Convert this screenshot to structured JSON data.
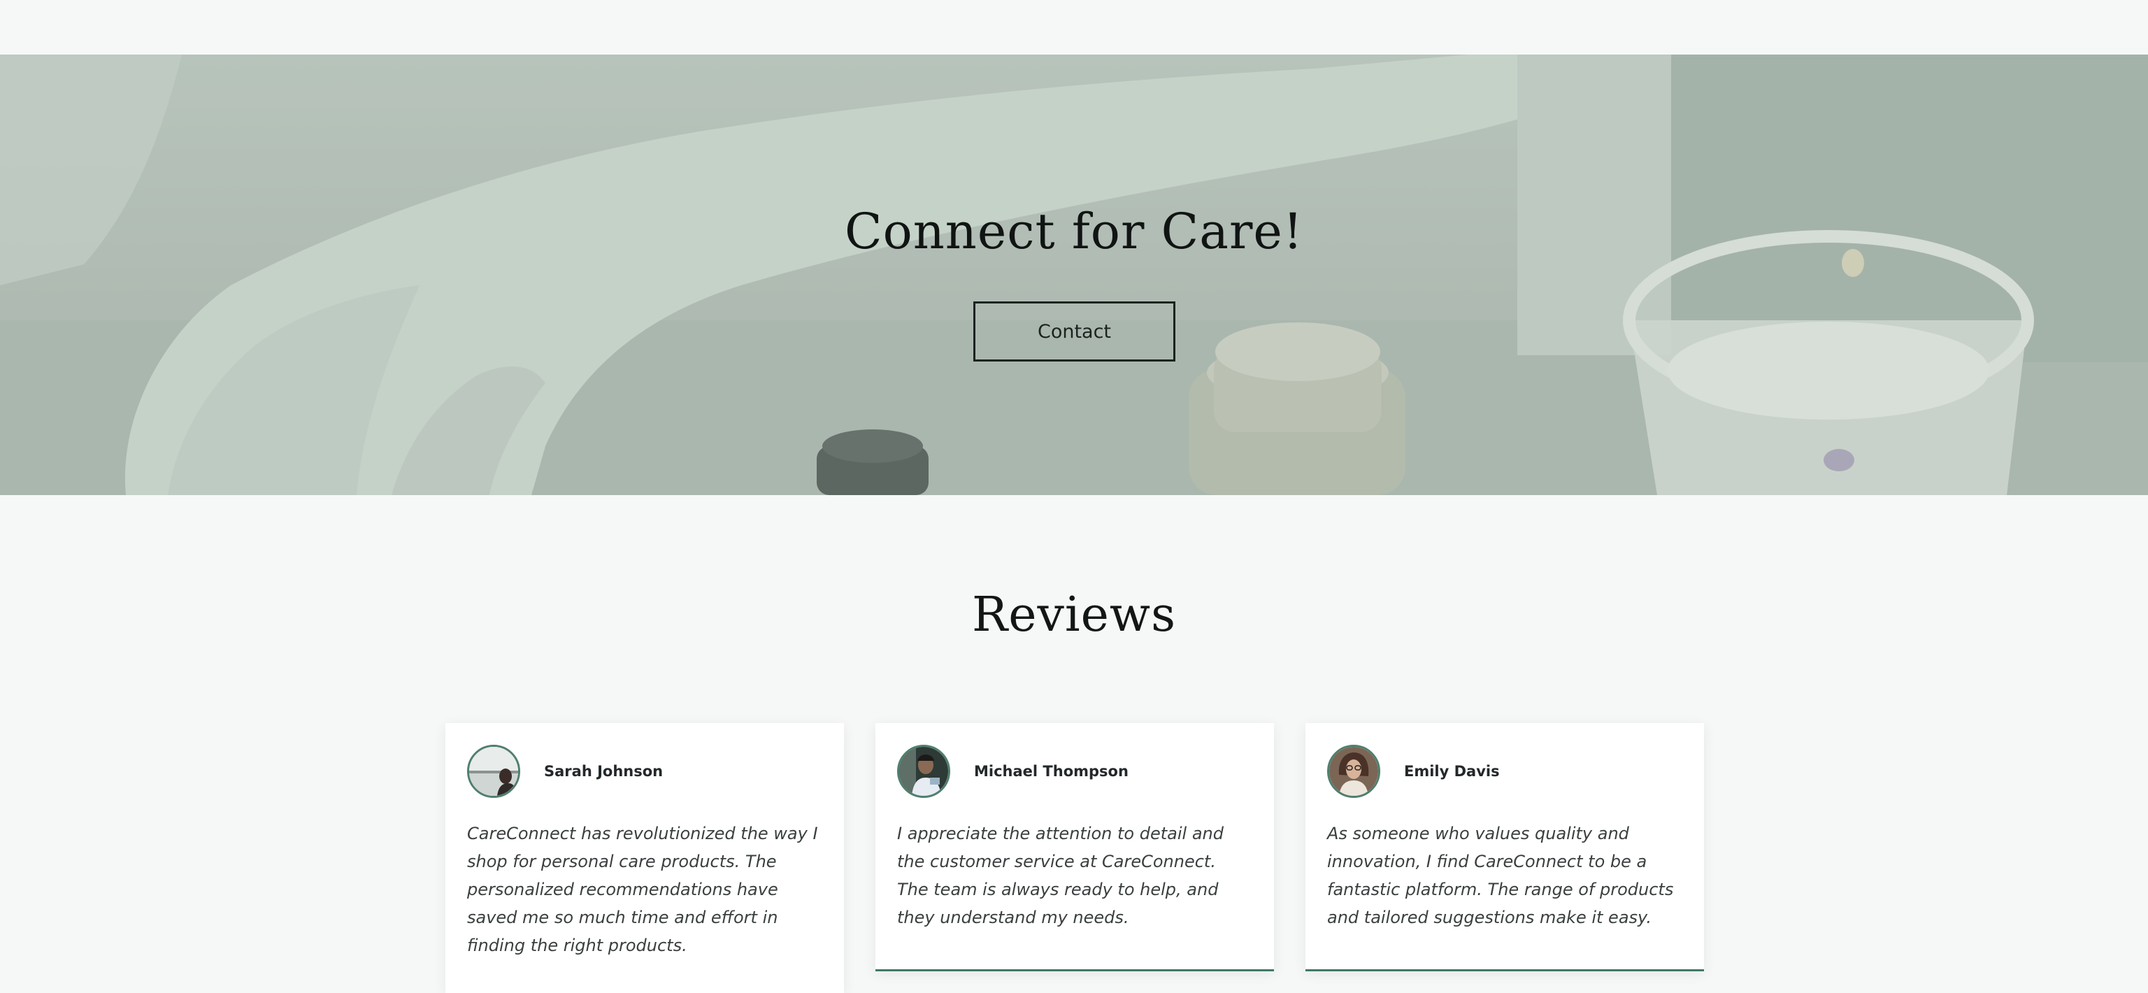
{
  "hero": {
    "title": "Connect for Care!",
    "contact_label": "Contact"
  },
  "reviews": {
    "title": "Reviews",
    "items": [
      {
        "name": "Sarah Johnson",
        "text": "CareConnect has revolutionized the way I shop for personal care products. The personalized recommendations have saved me so much time and effort in finding the right products."
      },
      {
        "name": "Michael Thompson",
        "text": "I appreciate the attention to detail and the customer service at CareConnect. The team is always ready to help, and they understand my needs."
      },
      {
        "name": "Emily Davis",
        "text": "As someone who values quality and innovation, I find CareConnect to be a fantastic platform. The range of products and tailored suggestions make it easy."
      }
    ]
  },
  "colors": {
    "accent": "#3f7a66",
    "background": "#f6f8f7",
    "hero_overlay": "#a9b7ae"
  },
  "icons": {
    "hero_image": "spa-hand-candle-image",
    "avatars": [
      "avatar-photo",
      "avatar-photo",
      "avatar-photo"
    ]
  }
}
